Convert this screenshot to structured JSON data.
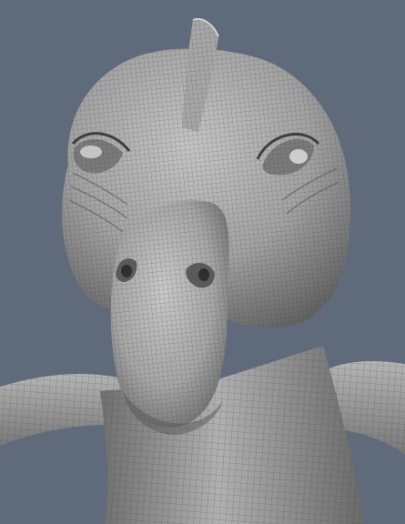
{
  "viewport": {
    "background_color": "#5f6b7b",
    "subject": "creature-head-wireframe-sculpt",
    "mesh_color": "#9a9a9a",
    "wire_color": "#3c3c3c"
  }
}
